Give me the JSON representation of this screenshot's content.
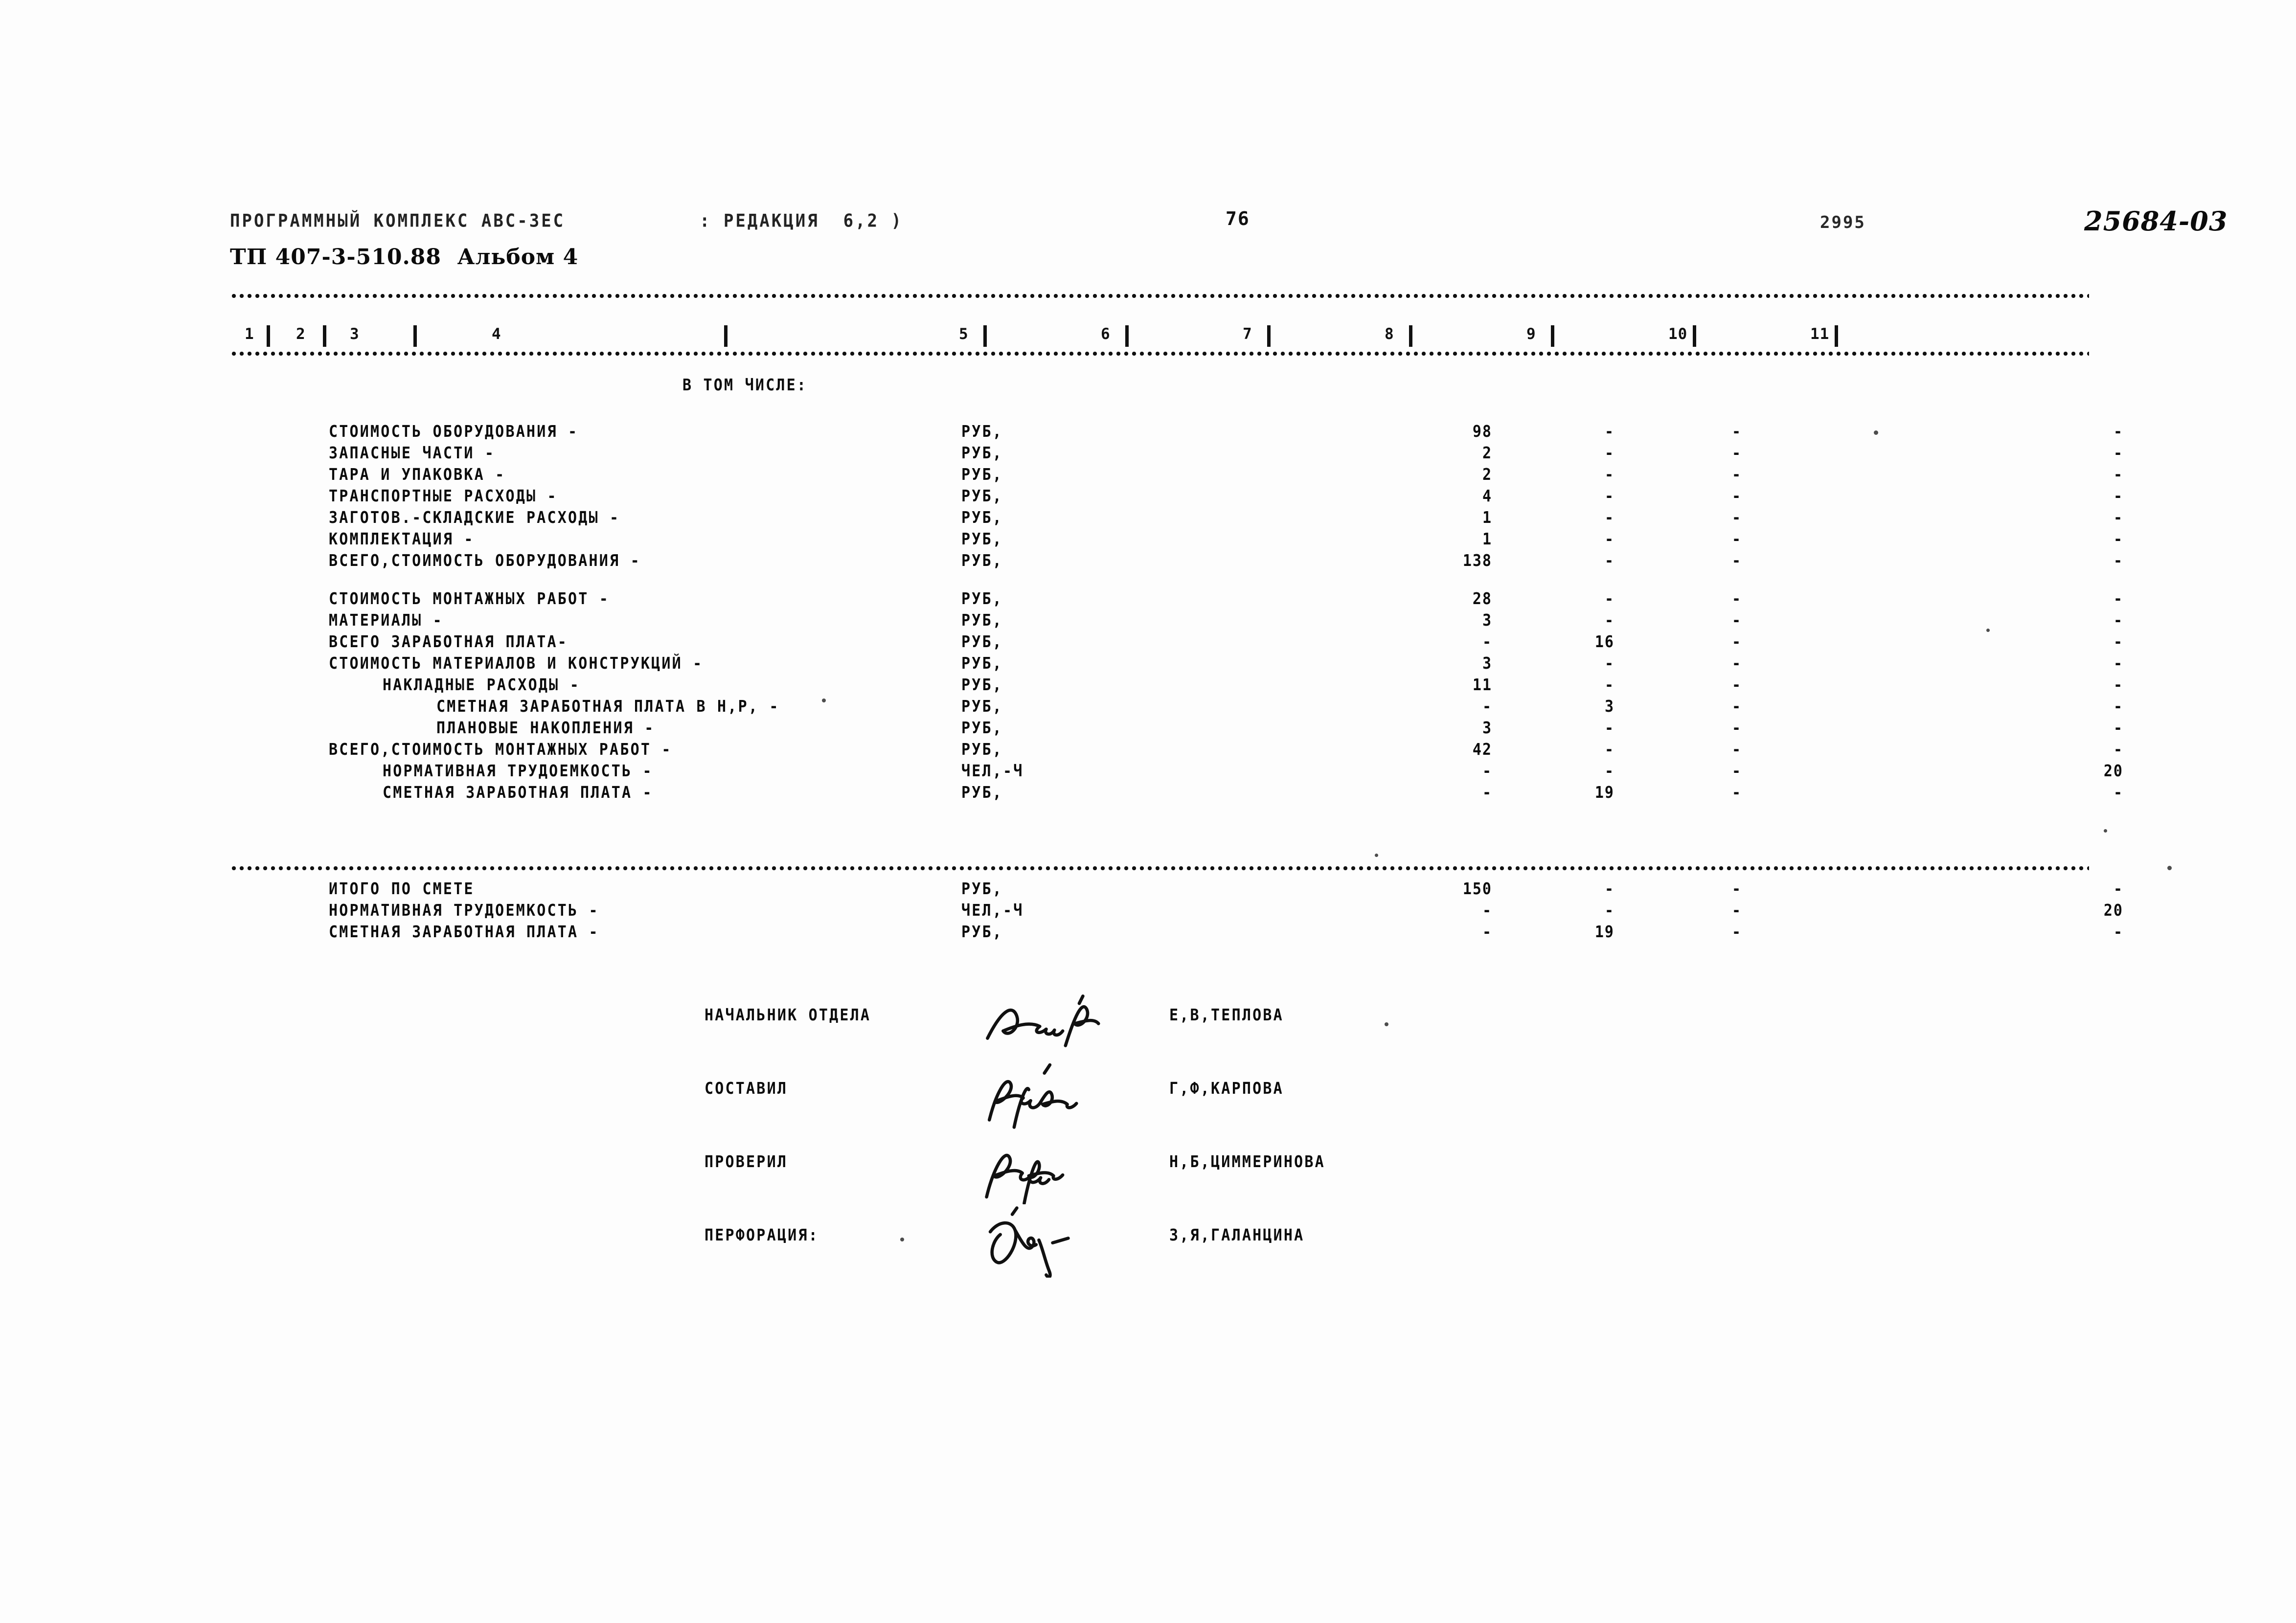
{
  "header": {
    "program_line": "ПРОГРАММНЫЙ КОМПЛЕКС АВС-ЗЕС",
    "redaction_line": ": РЕДАКЦИЯ  6,2 )",
    "album_line": "ТП 407-3-510.88  Альбом 4",
    "page_number": "76",
    "code": "2995",
    "document_number": "25684-03"
  },
  "columns": {
    "numbers": [
      "1",
      "2",
      "3",
      "4",
      "5",
      "6",
      "7",
      "8",
      "9",
      "10",
      "11"
    ]
  },
  "section_caption": "В ТОМ ЧИСЛЕ:",
  "rows": [
    {
      "label": "СТОИМОСТЬ ОБОРУДОВАНИЯ -",
      "indent": 0,
      "unit": "РУБ,",
      "c7": "98",
      "c8": "-",
      "c9": "-",
      "c10": "",
      "c11": "-"
    },
    {
      "label": "ЗАПАСНЫЕ ЧАСТИ -",
      "indent": 0,
      "unit": "РУБ,",
      "c7": "2",
      "c8": "-",
      "c9": "-",
      "c10": "",
      "c11": "-"
    },
    {
      "label": "ТАРА И УПАКОВКА -",
      "indent": 0,
      "unit": "РУБ,",
      "c7": "2",
      "c8": "-",
      "c9": "-",
      "c10": "",
      "c11": "-"
    },
    {
      "label": "ТРАНСПОРТНЫЕ РАСХОДЫ -",
      "indent": 0,
      "unit": "РУБ,",
      "c7": "4",
      "c8": "-",
      "c9": "-",
      "c10": "",
      "c11": "-"
    },
    {
      "label": "ЗАГОТОВ.-СКЛАДСКИЕ РАСХОДЫ -",
      "indent": 0,
      "unit": "РУБ,",
      "c7": "1",
      "c8": "-",
      "c9": "-",
      "c10": "",
      "c11": "-"
    },
    {
      "label": "КОМПЛЕКТАЦИЯ -",
      "indent": 0,
      "unit": "РУБ,",
      "c7": "1",
      "c8": "-",
      "c9": "-",
      "c10": "",
      "c11": "-"
    },
    {
      "label": "ВСЕГО,СТОИМОСТЬ ОБОРУДОВАНИЯ -",
      "indent": 0,
      "unit": "РУБ,",
      "c7": "138",
      "c8": "-",
      "c9": "-",
      "c10": "",
      "c11": "-"
    },
    {
      "label": "СТОИМОСТЬ МОНТАЖНЫХ РАБОТ -",
      "indent": 0,
      "unit": "РУБ,",
      "c7": "28",
      "c8": "-",
      "c9": "-",
      "c10": "",
      "c11": "-",
      "gap": true
    },
    {
      "label": "МАТЕРИАЛЫ -",
      "indent": 0,
      "unit": "РУБ,",
      "c7": "3",
      "c8": "-",
      "c9": "-",
      "c10": "",
      "c11": "-"
    },
    {
      "label": "ВСЕГО ЗАРАБОТНАЯ ПЛАТА-",
      "indent": 0,
      "unit": "РУБ,",
      "c7": "-",
      "c8": "16",
      "c9": "-",
      "c10": "",
      "c11": "-"
    },
    {
      "label": "СТОИМОСТЬ МАТЕРИАЛОВ И КОНСТРУКЦИЙ -",
      "indent": 0,
      "unit": "РУБ,",
      "c7": "3",
      "c8": "-",
      "c9": "-",
      "c10": "",
      "c11": "-"
    },
    {
      "label": "НАКЛАДНЫЕ РАСХОДЫ -",
      "indent": 1,
      "unit": "РУБ,",
      "c7": "11",
      "c8": "-",
      "c9": "-",
      "c10": "",
      "c11": "-"
    },
    {
      "label": "СМЕТНАЯ ЗАРАБОТНАЯ ПЛАТА В Н,Р, -",
      "indent": 2,
      "unit": "РУБ,",
      "c7": "-",
      "c8": "3",
      "c9": "-",
      "c10": "",
      "c11": "-"
    },
    {
      "label": "ПЛАНОВЫЕ НАКОПЛЕНИЯ -",
      "indent": 2,
      "unit": "РУБ,",
      "c7": "3",
      "c8": "-",
      "c9": "-",
      "c10": "",
      "c11": "-"
    },
    {
      "label": "ВСЕГО,СТОИМОСТЬ МОНТАЖНЫХ РАБОТ -",
      "indent": 0,
      "unit": "РУБ,",
      "c7": "42",
      "c8": "-",
      "c9": "-",
      "c10": "",
      "c11": "-"
    },
    {
      "label": "НОРМАТИВНАЯ ТРУДОЕМКОСТЬ -",
      "indent": 1,
      "unit": "ЧЕЛ,-Ч",
      "c7": "-",
      "c8": "-",
      "c9": "-",
      "c10": "",
      "c11": "20"
    },
    {
      "label": "СМЕТНАЯ ЗАРАБОТНАЯ ПЛАТА -",
      "indent": 1,
      "unit": "РУБ,",
      "c7": "-",
      "c8": "19",
      "c9": "-",
      "c10": "",
      "c11": "-"
    }
  ],
  "totals": [
    {
      "label": "ИТОГО ПО СМЕТЕ",
      "indent": 0,
      "unit": "РУБ,",
      "c7": "150",
      "c8": "-",
      "c9": "-",
      "c10": "",
      "c11": "-"
    },
    {
      "label": "НОРМАТИВНАЯ ТРУДОЕМКОСТЬ -",
      "indent": 0,
      "unit": "ЧЕЛ,-Ч",
      "c7": "-",
      "c8": "-",
      "c9": "-",
      "c10": "",
      "c11": "20"
    },
    {
      "label": "СМЕТНАЯ ЗАРАБОТНАЯ ПЛАТА -",
      "indent": 0,
      "unit": "РУБ,",
      "c7": "-",
      "c8": "19",
      "c9": "-",
      "c10": "",
      "c11": "-"
    }
  ],
  "signatures": [
    {
      "role": "НАЧАЛЬНИК ОТДЕЛА",
      "name": "Е,В,ТЕПЛОВА"
    },
    {
      "role": "СОСТАВИЛ",
      "name": "Г,Ф,КАРПОВА"
    },
    {
      "role": "ПРОВЕРИЛ",
      "name": "Н,Б,ЦИММЕРИНОВА"
    },
    {
      "role": "ПЕРФОРАЦИЯ:",
      "name": "З,Я,ГАЛАНЦИНА"
    }
  ],
  "colors": {
    "ink": "#111111",
    "paper": "#fdfdfd"
  }
}
